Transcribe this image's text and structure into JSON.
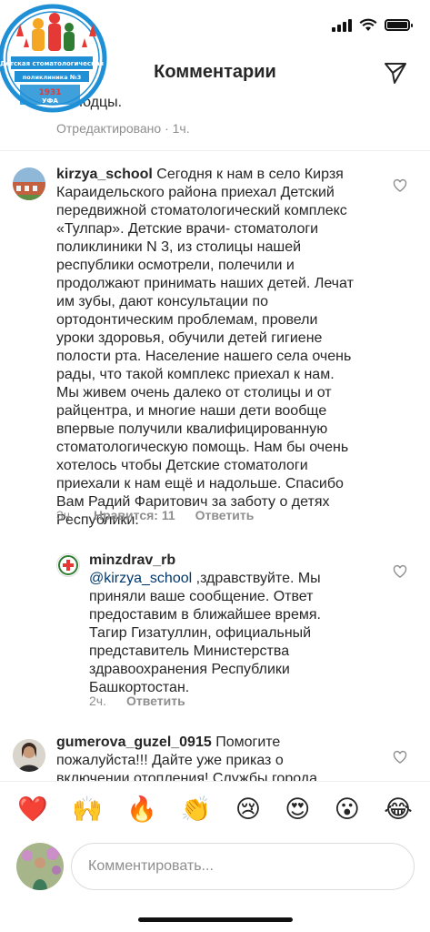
{
  "logo": {
    "line1": "Детская стоматологическая",
    "line2": "поликлиника №3",
    "year": "1931",
    "city": "УФА"
  },
  "header": {
    "title": "Комментарии"
  },
  "previous": {
    "tail": "молодцы.",
    "meta": "Отредактировано · 1ч."
  },
  "comments": [
    {
      "username": "kirzya_school",
      "text_lines": [
        " Сегодня к нам в село Кирзя",
        "Караидельского района приехал Детский",
        "передвижной стоматологический комплекс",
        "«Тулпар». Детские врачи- стоматологи",
        "поликлиники N 3, из столицы нашей",
        "республики осмотрели, полечили и",
        "продолжают принимать наших детей. Лечат",
        "им зубы, дают консультации по",
        "ортодонтическим проблемам, провели",
        "уроки здоровья, обучили детей гигиене",
        "полости рта. Население нашего села очень",
        "рады, что такой комплекс приехал к нам.",
        "Мы живем очень далеко от столицы и от",
        "райцентра, и многие наши дети вообще",
        "впервые получили квалифицированную",
        "стоматологическую помощь. Нам бы очень",
        "хотелось чтобы Детские стоматологи",
        "приехали к нам ещё и надольше. Спасибо",
        "Вам Радий Фаритович за заботу о детях",
        "Республики."
      ],
      "time": "3ч.",
      "likes": "Нравится: 11",
      "reply": "Ответить"
    },
    {
      "username": "minzdrav_rb",
      "mention": "@kirzya_school",
      "text_lines": [
        " ,здравствуйте. Мы",
        "приняли ваше сообщение. Ответ",
        "предоставим в ближайшее время.",
        "Тагир Гизатуллин, официальный",
        "представитель Министерства",
        "здравоохранения Республики",
        "Башкортостан."
      ],
      "time": "2ч.",
      "reply": "Ответить"
    },
    {
      "username": "gumerova_guzel_0915",
      "text_lines": [
        " Помогите",
        "пожалуйста!!! Дайте уже приказ о",
        "включении отопления! Службы города"
      ]
    }
  ],
  "emojis": [
    "❤️",
    "🙌",
    "🔥",
    "👏",
    "😢",
    "😍",
    "😮",
    "😂"
  ],
  "compose": {
    "placeholder": "Комментировать..."
  }
}
